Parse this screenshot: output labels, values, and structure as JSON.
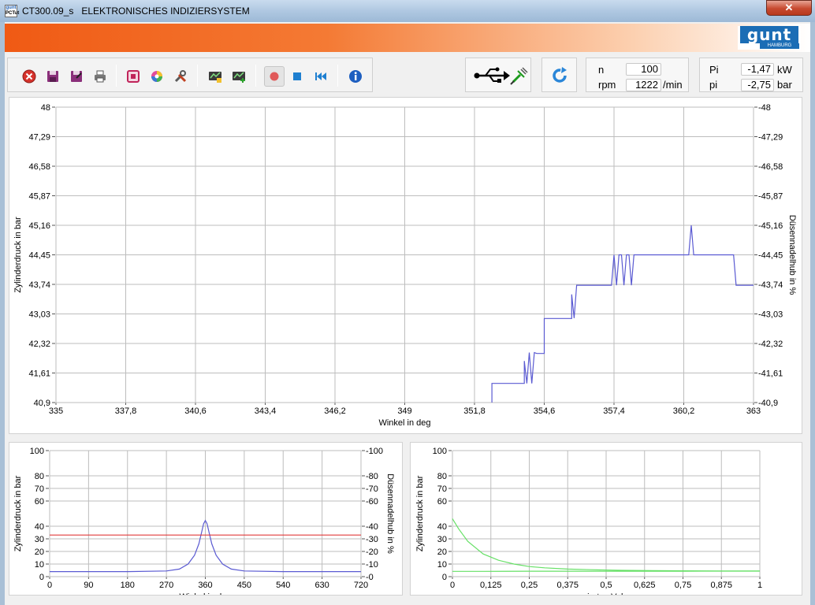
{
  "window": {
    "title": "CT300.09_s   ELEKTRONISCHES INDIZIERSYSTEM",
    "icon_top": "gunt",
    "icon_bottom": "PCTut",
    "close_icon": "close-icon",
    "close_glyph": "✕"
  },
  "logo": {
    "text": "gunt",
    "subtext": "HAMBURG"
  },
  "toolbar": {
    "buttons": [
      {
        "name": "exit-button",
        "icon": "exit-icon",
        "color": "#d6322c"
      },
      {
        "name": "save-button",
        "icon": "save-icon",
        "color": "#8a2f7a"
      },
      {
        "name": "save-as-button",
        "icon": "save-as-icon",
        "color": "#8a2f7a"
      },
      {
        "name": "print-button",
        "icon": "print-icon",
        "color": "#555555"
      },
      {
        "name": "channel-button",
        "icon": "channel-icon",
        "color": "#c0245a"
      },
      {
        "name": "color-settings-button",
        "icon": "color-wheel-icon",
        "color": "#e04b9b"
      },
      {
        "name": "tools-button",
        "icon": "tools-icon",
        "color": "#5a5a5a"
      },
      {
        "name": "load-measurement-button",
        "icon": "load-measurement-icon",
        "color": "#3a7d2a"
      },
      {
        "name": "add-measurement-button",
        "icon": "add-measurement-icon",
        "color": "#3a7d2a"
      },
      {
        "name": "record-button",
        "icon": "record-icon",
        "color": "#e05a5a"
      },
      {
        "name": "stop-button",
        "icon": "stop-icon",
        "color": "#1e7fd0"
      },
      {
        "name": "rewind-button",
        "icon": "rewind-icon",
        "color": "#1e7fd0"
      },
      {
        "name": "info-button",
        "icon": "info-icon",
        "color": "#1e5fc0"
      }
    ]
  },
  "connection": {
    "icon": "usb-plug-icon"
  },
  "refresh": {
    "icon": "refresh-icon"
  },
  "engine": {
    "n_label": "n",
    "n_value": "100",
    "rpm_label": "rpm",
    "rpm_value": "1222",
    "rpm_unit": "/min"
  },
  "power": {
    "pi_upper_label": "Pi",
    "pi_upper_value": "-1,47",
    "pi_upper_unit": "kW",
    "pi_lower_label": "pi",
    "pi_lower_value": "-2,75",
    "pi_lower_unit": "bar"
  },
  "colors": {
    "trace_blue": "#5a5ad2",
    "red_line": "#e23b3b",
    "trace_green": "#66e066",
    "grid": "#bdbdbd",
    "banner_orange": "#f05a14"
  },
  "chart_data": [
    {
      "type": "line",
      "xlabel": "Winkel in deg",
      "ylabel": "Zylinderdruck in bar",
      "y2label": "Düsennadelhub in %",
      "xlim": [
        335,
        363
      ],
      "ylim": [
        40.9,
        48
      ],
      "x_ticks": [
        "335",
        "337,8",
        "340,6",
        "343,4",
        "346,2",
        "349",
        "351,8",
        "354,6",
        "357,4",
        "360,2",
        "363"
      ],
      "y_ticks": [
        "40,9",
        "41,61",
        "42,32",
        "43,03",
        "43,74",
        "44,45",
        "45,16",
        "45,87",
        "46,58",
        "47,29",
        "48"
      ],
      "grid": true,
      "series": [
        {
          "color": "#5a5ad2",
          "x": [
            352.5,
            352.5,
            353.8,
            353.8,
            353.9,
            354.0,
            354.1,
            354.2,
            354.3,
            354.3,
            354.6,
            354.6,
            355.7,
            355.7,
            355.8,
            355.9,
            356.1,
            356.1,
            357.3,
            357.4,
            357.5,
            357.6,
            357.7,
            357.8,
            357.9,
            358.0,
            358.1,
            358.2,
            358.3,
            360.3,
            360.4,
            360.5,
            360.6,
            360.7,
            362.2,
            362.3,
            363.0
          ],
          "y": [
            40.9,
            41.36,
            41.36,
            41.9,
            41.36,
            42.1,
            41.36,
            42.1,
            42.08,
            42.08,
            42.08,
            42.92,
            42.92,
            43.5,
            42.93,
            43.72,
            43.72,
            43.72,
            43.72,
            44.45,
            43.72,
            44.45,
            44.45,
            43.72,
            44.45,
            44.45,
            43.72,
            44.45,
            44.45,
            44.45,
            44.45,
            45.16,
            44.45,
            44.45,
            44.45,
            43.72,
            43.72
          ]
        }
      ]
    },
    {
      "type": "line",
      "xlabel": "Winkel in deg",
      "ylabel": "Zylinderdruck in bar",
      "y2label": "Düsennadelhub in %",
      "xlim": [
        0,
        720
      ],
      "ylim": [
        0,
        100
      ],
      "x_ticks": [
        "0",
        "90",
        "180",
        "270",
        "360",
        "450",
        "540",
        "630",
        "720"
      ],
      "y_ticks": [
        "0",
        "10",
        "20",
        "30",
        "40",
        "60",
        "70",
        "80",
        "100"
      ],
      "y2_ticks": [
        "0",
        "10",
        "20",
        "30",
        "40",
        "60",
        "70",
        "80",
        "100"
      ],
      "grid": true,
      "series": [
        {
          "color": "#5a5ad2",
          "x": [
            0,
            90,
            180,
            270,
            300,
            320,
            335,
            345,
            352,
            356,
            360,
            364,
            368,
            375,
            385,
            400,
            420,
            450,
            540,
            630,
            720
          ],
          "y": [
            4,
            4,
            4,
            4.5,
            6,
            10,
            17,
            26,
            36,
            42,
            44.5,
            42,
            36,
            26,
            17,
            10,
            6,
            4.5,
            4,
            4,
            4
          ]
        },
        {
          "color": "#e23b3b",
          "x": [
            0,
            720
          ],
          "y": [
            33,
            33
          ]
        }
      ]
    },
    {
      "type": "line",
      "xlabel": "normiertes Volumen",
      "ylabel": "Zylinderdruck in bar",
      "xlim": [
        0,
        1
      ],
      "ylim": [
        0,
        100
      ],
      "x_ticks": [
        "0",
        "0,125",
        "0,25",
        "0,375",
        "0,5",
        "0,625",
        "0,75",
        "0,875",
        "1"
      ],
      "y_ticks": [
        "0",
        "10",
        "20",
        "30",
        "40",
        "60",
        "70",
        "80",
        "100"
      ],
      "grid": true,
      "series": [
        {
          "color": "#66e066",
          "x": [
            0,
            0.02,
            0.05,
            0.1,
            0.15,
            0.2,
            0.25,
            0.3,
            0.375,
            0.45,
            0.55,
            0.65,
            0.75,
            0.875,
            1
          ],
          "y": [
            46,
            38,
            28,
            18,
            13,
            10,
            8,
            7,
            6,
            5.5,
            5,
            4.8,
            4.6,
            4.5,
            4.5
          ]
        },
        {
          "color": "#66e066",
          "x": [
            0,
            0.1,
            0.25,
            0.5,
            0.75,
            1
          ],
          "y": [
            4.2,
            4.2,
            4.3,
            4.3,
            4.3,
            4.4
          ]
        }
      ]
    }
  ]
}
